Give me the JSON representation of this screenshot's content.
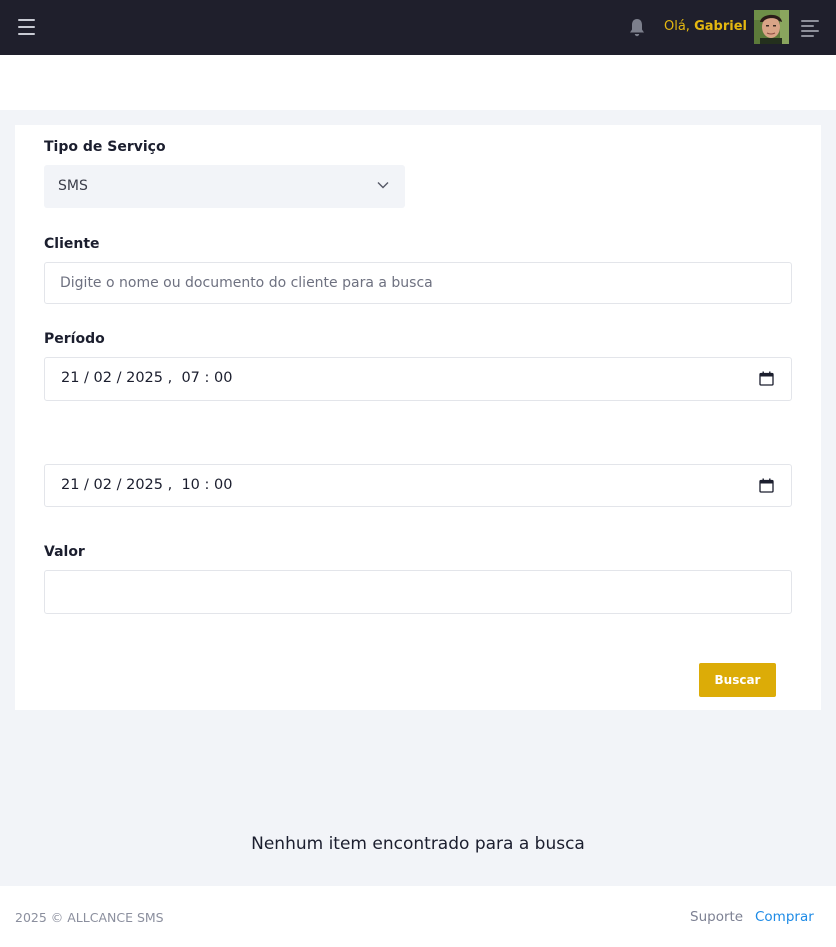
{
  "topbar": {
    "greeting_prefix": "Olá,",
    "user_name": "Gabriel"
  },
  "form": {
    "service_type": {
      "label": "Tipo de Serviço",
      "selected": "SMS"
    },
    "client": {
      "label": "Cliente",
      "placeholder": "Digite o nome ou documento do cliente para a busca"
    },
    "period": {
      "label": "Período",
      "start": "21 / 02 / 2025 ,  07 : 00",
      "end": "21 / 02 / 2025 ,  10 : 00"
    },
    "value": {
      "label": "Valor",
      "value": ""
    },
    "search_button": "Buscar"
  },
  "results": {
    "empty_message": "Nenhum item encontrado para a busca"
  },
  "footer": {
    "copyright": "2025 © ALLCANCE SMS",
    "support_link": "Suporte",
    "buy_link": "Comprar"
  },
  "colors": {
    "topbar_bg": "#1f1f2c",
    "accent": "#dcac07",
    "greeting": "#e5b810",
    "link": "#1e8be6"
  },
  "icons": [
    "hamburger-menu-icon",
    "bell-icon",
    "chevron-down-icon",
    "calendar-icon",
    "sidebar-toggle-icon"
  ]
}
